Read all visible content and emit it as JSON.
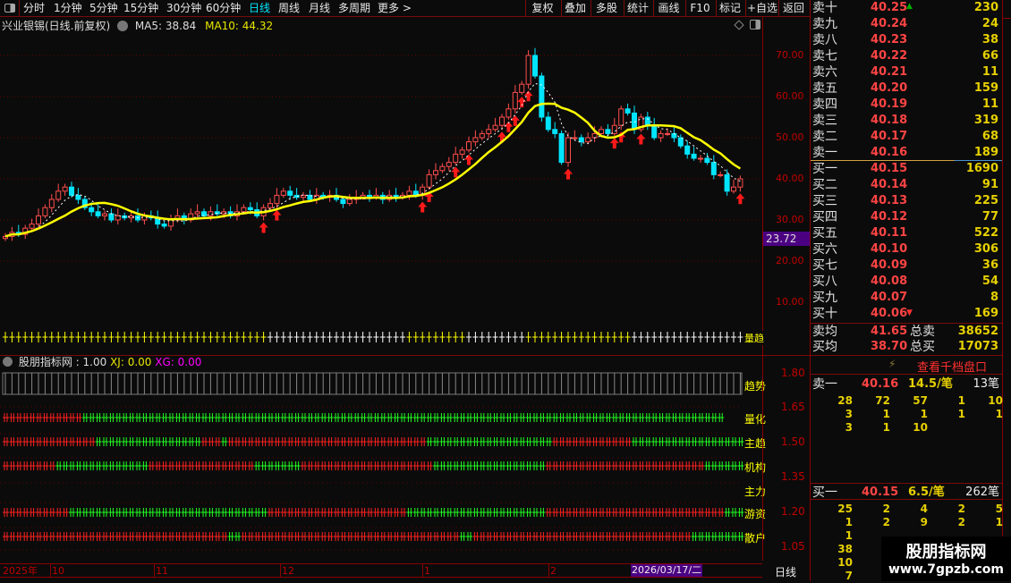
{
  "toolbar": {
    "periods": [
      "分时",
      "1分钟",
      "5分钟",
      "15分钟",
      "30分钟",
      "60分钟",
      "日线",
      "周线",
      "月线",
      "多周期",
      "更多 >"
    ],
    "active": "日线",
    "buttons": [
      "复权",
      "叠加",
      "多股",
      "统计",
      "画线",
      "F10",
      "标记",
      "+自选",
      "返回"
    ]
  },
  "title": {
    "name": "兴业银锡(日线.前复权)",
    "ma5": "MA5: 38.84",
    "ma10": "MA10: 44.32"
  },
  "price_axis": {
    "labels": [
      "70.00",
      "60.00",
      "50.00",
      "40.00",
      "30.00",
      "20.00",
      "10.00"
    ],
    "current": "23.72"
  },
  "strip_label": "量趋",
  "indicator": {
    "name": "股朋指标网",
    "value": ": 1.00",
    "xj": "XJ: 0.00",
    "xg": "XG: 0.00",
    "rows": [
      "趋势",
      "量化",
      "主趋",
      "机构",
      "主力",
      "游资",
      "散户"
    ],
    "axis": [
      "1.80",
      "1.65",
      "1.50",
      "1.35",
      "1.20",
      "1.05"
    ]
  },
  "datebar": {
    "labels": [
      "2025年",
      "10",
      "11",
      "12",
      "1",
      "2"
    ],
    "cursor": "2026/03/17/二",
    "period": "日线"
  },
  "orderbook": {
    "sells": [
      {
        "n": "卖十",
        "p": "40.25",
        "v": "230"
      },
      {
        "n": "卖九",
        "p": "40.24",
        "v": "24"
      },
      {
        "n": "卖八",
        "p": "40.23",
        "v": "38"
      },
      {
        "n": "卖七",
        "p": "40.22",
        "v": "66"
      },
      {
        "n": "卖六",
        "p": "40.21",
        "v": "11"
      },
      {
        "n": "卖五",
        "p": "40.20",
        "v": "159"
      },
      {
        "n": "卖四",
        "p": "40.19",
        "v": "11"
      },
      {
        "n": "卖三",
        "p": "40.18",
        "v": "319"
      },
      {
        "n": "卖二",
        "p": "40.17",
        "v": "68"
      },
      {
        "n": "卖一",
        "p": "40.16",
        "v": "189"
      }
    ],
    "buys": [
      {
        "n": "买一",
        "p": "40.15",
        "v": "1690"
      },
      {
        "n": "买二",
        "p": "40.14",
        "v": "91"
      },
      {
        "n": "买三",
        "p": "40.13",
        "v": "225"
      },
      {
        "n": "买四",
        "p": "40.12",
        "v": "77"
      },
      {
        "n": "买五",
        "p": "40.11",
        "v": "522"
      },
      {
        "n": "买六",
        "p": "40.10",
        "v": "306"
      },
      {
        "n": "买七",
        "p": "40.09",
        "v": "36"
      },
      {
        "n": "买八",
        "p": "40.08",
        "v": "54"
      },
      {
        "n": "买九",
        "p": "40.07",
        "v": "8"
      },
      {
        "n": "买十",
        "p": "40.06",
        "v": "169"
      }
    ],
    "avg_sell_label": "卖均",
    "avg_sell": "41.65",
    "total_sell_label": "总卖",
    "total_sell": "38652",
    "avg_buy_label": "买均",
    "avg_buy": "38.70",
    "total_buy_label": "总买",
    "total_buy": "17073",
    "depth_link": "查看千档盘口",
    "sell1": {
      "n": "卖一",
      "p": "40.16",
      "avg": "14.5/笔",
      "count": "13笔",
      "orders": [
        [
          "28",
          "72",
          "57",
          "1",
          "10"
        ],
        [
          "3",
          "1",
          "1",
          "1",
          "1"
        ],
        [
          "3",
          "1",
          "10"
        ]
      ]
    },
    "buy1": {
      "n": "买一",
      "p": "40.15",
      "avg": "6.5/笔",
      "count": "262笔",
      "orders": [
        [
          "25",
          "2",
          "4",
          "2",
          "5"
        ],
        [
          "1",
          "2",
          "9",
          "2",
          "1"
        ],
        [
          "1",
          "",
          "",
          "",
          ""
        ],
        [
          "38"
        ],
        [
          "10"
        ],
        [
          "7"
        ]
      ]
    }
  },
  "watermark": {
    "title": "股朋指标网",
    "url": "www.7gpzb.com"
  },
  "chart_data": {
    "type": "candlestick",
    "ylim": [
      0,
      80
    ],
    "close": [
      26,
      27,
      26.5,
      28,
      29,
      31,
      33,
      35,
      37,
      38,
      36,
      35,
      33,
      32,
      31,
      31.5,
      30,
      31,
      30.5,
      31,
      30,
      31,
      30.5,
      29,
      28.5,
      30,
      31,
      30,
      31.5,
      32,
      31,
      32,
      31.5,
      32,
      31,
      32,
      33,
      32.5,
      31,
      33,
      34,
      36,
      37,
      36,
      35.5,
      36,
      35,
      36,
      35.5,
      36,
      35,
      34,
      35,
      35.5,
      36,
      35.5,
      36,
      35,
      36,
      35.5,
      36,
      37,
      36,
      38,
      41,
      42,
      43,
      44,
      46,
      47,
      49,
      50,
      51,
      52,
      53,
      55,
      57,
      61,
      63,
      70,
      65,
      55,
      52,
      51,
      44,
      50,
      50,
      49,
      50,
      51,
      52,
      51,
      53,
      57,
      56,
      52,
      55,
      53,
      50,
      51,
      51,
      50,
      48,
      46,
      45,
      45,
      44,
      41,
      41,
      37,
      38,
      40
    ],
    "series": [
      {
        "name": "MA5",
        "value": 38.84
      },
      {
        "name": "MA10",
        "value": 44.32
      }
    ]
  }
}
